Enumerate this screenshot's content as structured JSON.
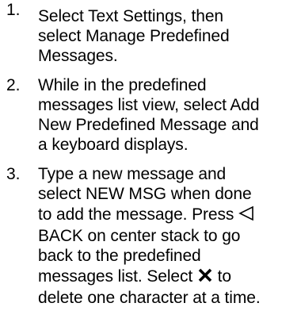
{
  "steps": [
    {
      "number": "1.",
      "lines": [
        "Select Text Settings, then",
        "select Manage Predefined",
        "Messages."
      ]
    },
    {
      "number": "2.",
      "lines": [
        "While in the predefined",
        "messages list view, select Add",
        "New Predefined Message and",
        "a keyboard displays."
      ]
    },
    {
      "number": "3.",
      "line1": "Type a new message and",
      "line2": "select NEW MSG when done",
      "line3_text": "to add the message. Press",
      "line4": "BACK on center stack to go",
      "line5": "back to the predefined",
      "line6_before": "messages list. Select",
      "line6_after": "to",
      "line7": "delete one character at a time."
    }
  ],
  "icons": {
    "back": "back-triangle-icon",
    "delete": "x-delete-icon"
  }
}
